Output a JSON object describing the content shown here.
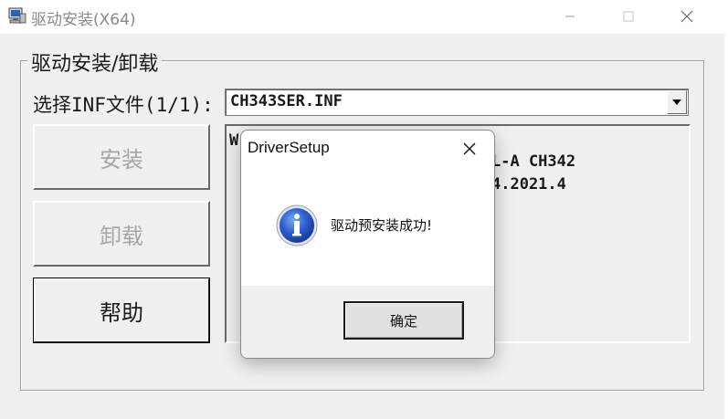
{
  "window": {
    "title": "驱动安装(X64)",
    "controls": {
      "minimize": "minimize",
      "maximize": "maximize",
      "close": "close"
    }
  },
  "group": {
    "label": "驱动安装/卸载"
  },
  "inf": {
    "label": "选择INF文件(1/1):",
    "selected": "CH343SER.INF"
  },
  "buttons": {
    "install": "安装",
    "uninstall": "卸载",
    "help": "帮助"
  },
  "info_panel": {
    "lines": [
      "W",
      "L-A CH342",
      "4.2021.4"
    ]
  },
  "dialog": {
    "title": "DriverSetup",
    "message": "驱动预安装成功!",
    "ok_label": "确定"
  },
  "colors": {
    "background": "#f0f0f0",
    "titlebar": "#ffffff",
    "disabled_text": "#a7a7a7",
    "info_icon_blue": "#1f4fb8"
  }
}
